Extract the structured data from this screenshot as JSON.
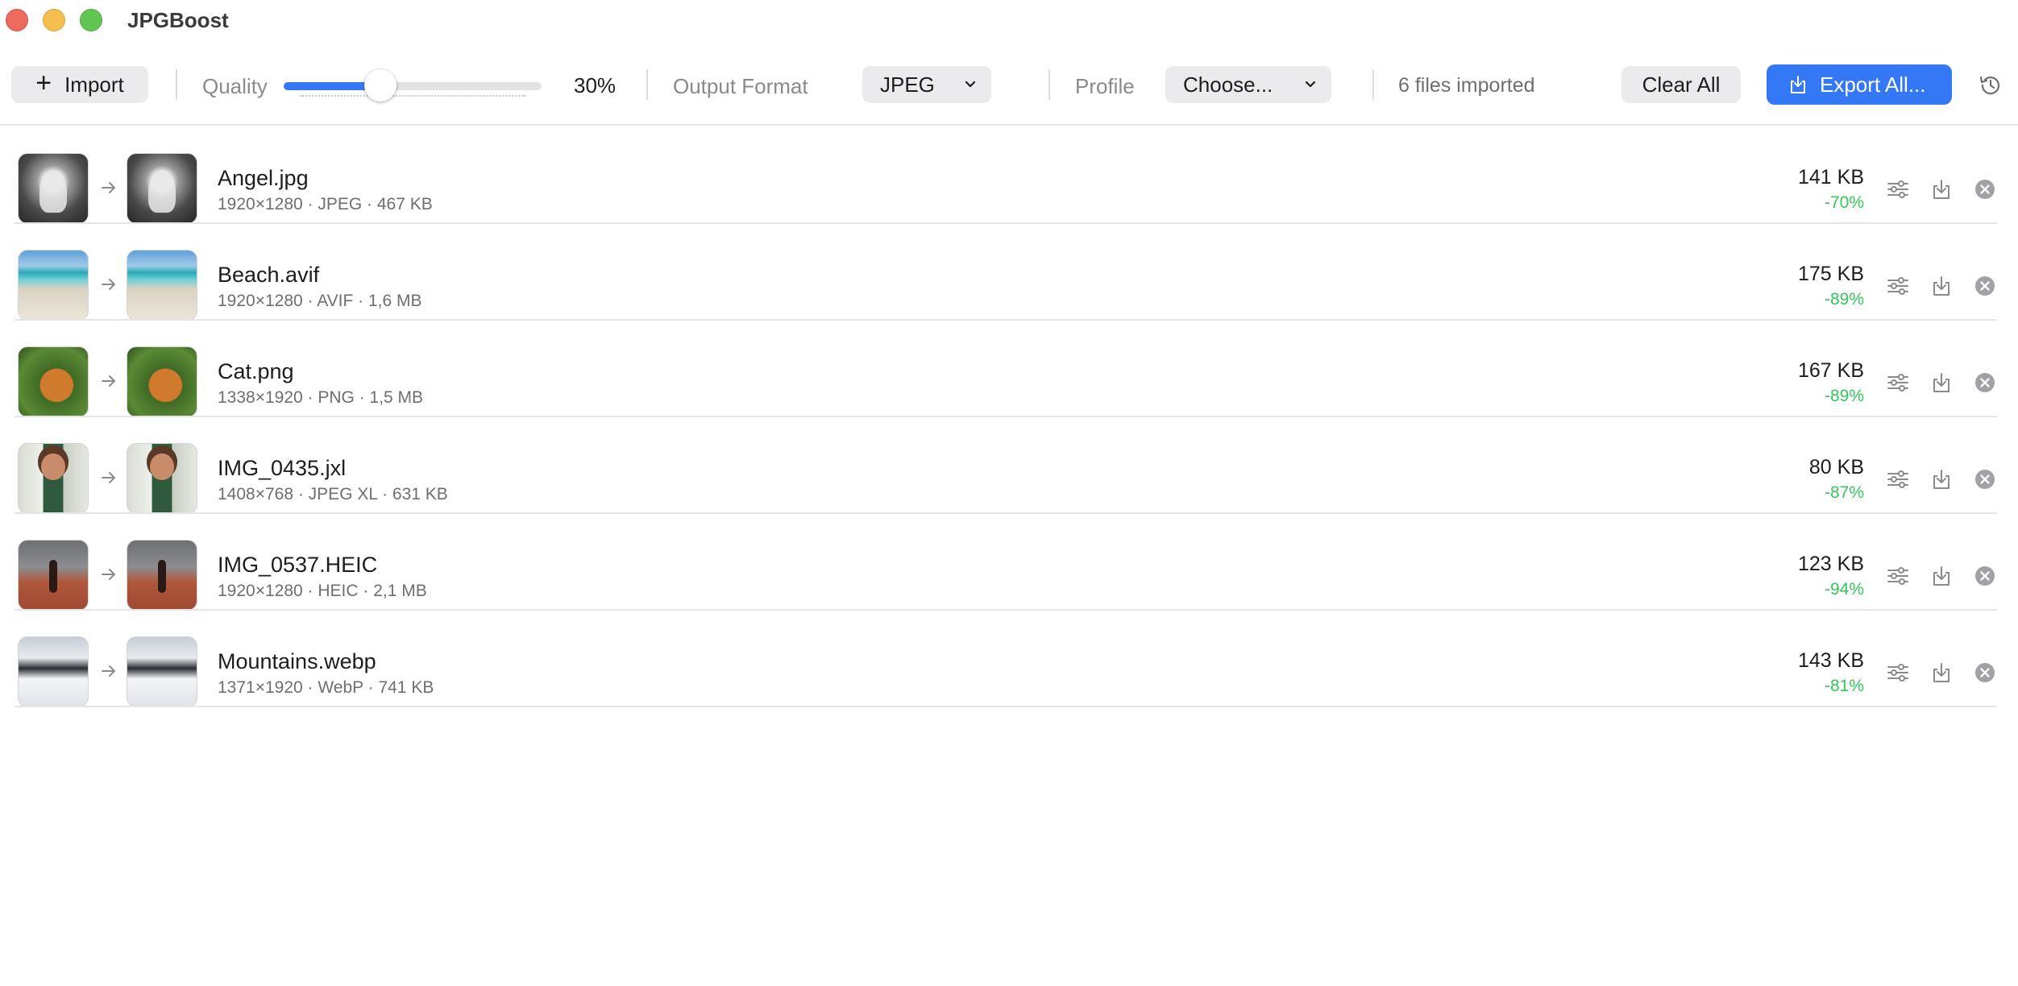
{
  "window": {
    "title": "JPGBoost"
  },
  "toolbar": {
    "import_label": "Import",
    "quality_label": "Quality",
    "quality_value": 30,
    "quality_text": "30%",
    "format_label": "Output Format",
    "format_value": "JPEG",
    "profile_label": "Profile",
    "profile_value": "Choose...",
    "files_count": "6 files imported",
    "clear_label": "Clear All",
    "export_label": "Export All..."
  },
  "colors": {
    "accent": "#3478f6",
    "savings": "#34c759"
  },
  "files": [
    {
      "name": "Angel.jpg",
      "meta": "1920×1280 · JPEG · 467 KB",
      "size": "141 KB",
      "reduction": "-70%",
      "thumb": "angel"
    },
    {
      "name": "Beach.avif",
      "meta": "1920×1280 · AVIF · 1,6 MB",
      "size": "175 KB",
      "reduction": "-89%",
      "thumb": "beach"
    },
    {
      "name": "Cat.png",
      "meta": "1338×1920 · PNG · 1,5 MB",
      "size": "167 KB",
      "reduction": "-89%",
      "thumb": "cat"
    },
    {
      "name": "IMG_0435.jxl",
      "meta": "1408×768 · JPEG XL · 631 KB",
      "size": "80 KB",
      "reduction": "-87%",
      "thumb": "woman"
    },
    {
      "name": "IMG_0537.HEIC",
      "meta": "1920×1280 · HEIC · 2,1 MB",
      "size": "123 KB",
      "reduction": "-94%",
      "thumb": "runner"
    },
    {
      "name": "Mountains.webp",
      "meta": "1371×1920 · WebP · 741 KB",
      "size": "143 KB",
      "reduction": "-81%",
      "thumb": "mountain"
    }
  ]
}
